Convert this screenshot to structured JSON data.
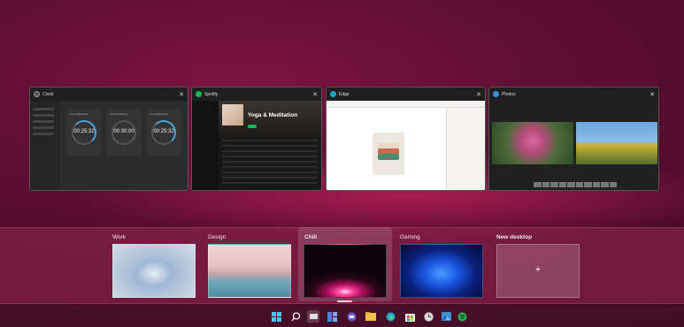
{
  "windows": [
    {
      "title": "Clock",
      "timers": [
        {
          "label": "Time Meditation",
          "time": "00:25:32"
        },
        {
          "label": "Insta Meditation",
          "time": "00:30:00"
        },
        {
          "label": "Time Meditation",
          "time": "00:25:32"
        }
      ]
    },
    {
      "title": "Spotify",
      "playlist_title": "Yoga & Meditation"
    },
    {
      "title": "Edge"
    },
    {
      "title": "Photos"
    }
  ],
  "desktops": [
    {
      "name": "Work"
    },
    {
      "name": "Design"
    },
    {
      "name": "Chill"
    },
    {
      "name": "Gaming"
    },
    {
      "name": "New desktop",
      "plus": "+"
    }
  ],
  "taskbar": {
    "icons": [
      "windows-start-icon",
      "search-icon",
      "task-view-icon",
      "widgets-icon",
      "chat-icon",
      "file-explorer-icon",
      "edge-icon",
      "microsoft-store-icon",
      "clock-app-icon",
      "photos-icon",
      "spotify-icon"
    ]
  },
  "colors": {
    "accent": "#4aa3df",
    "spotify_green": "#1db954",
    "background": "#5a0d31"
  }
}
